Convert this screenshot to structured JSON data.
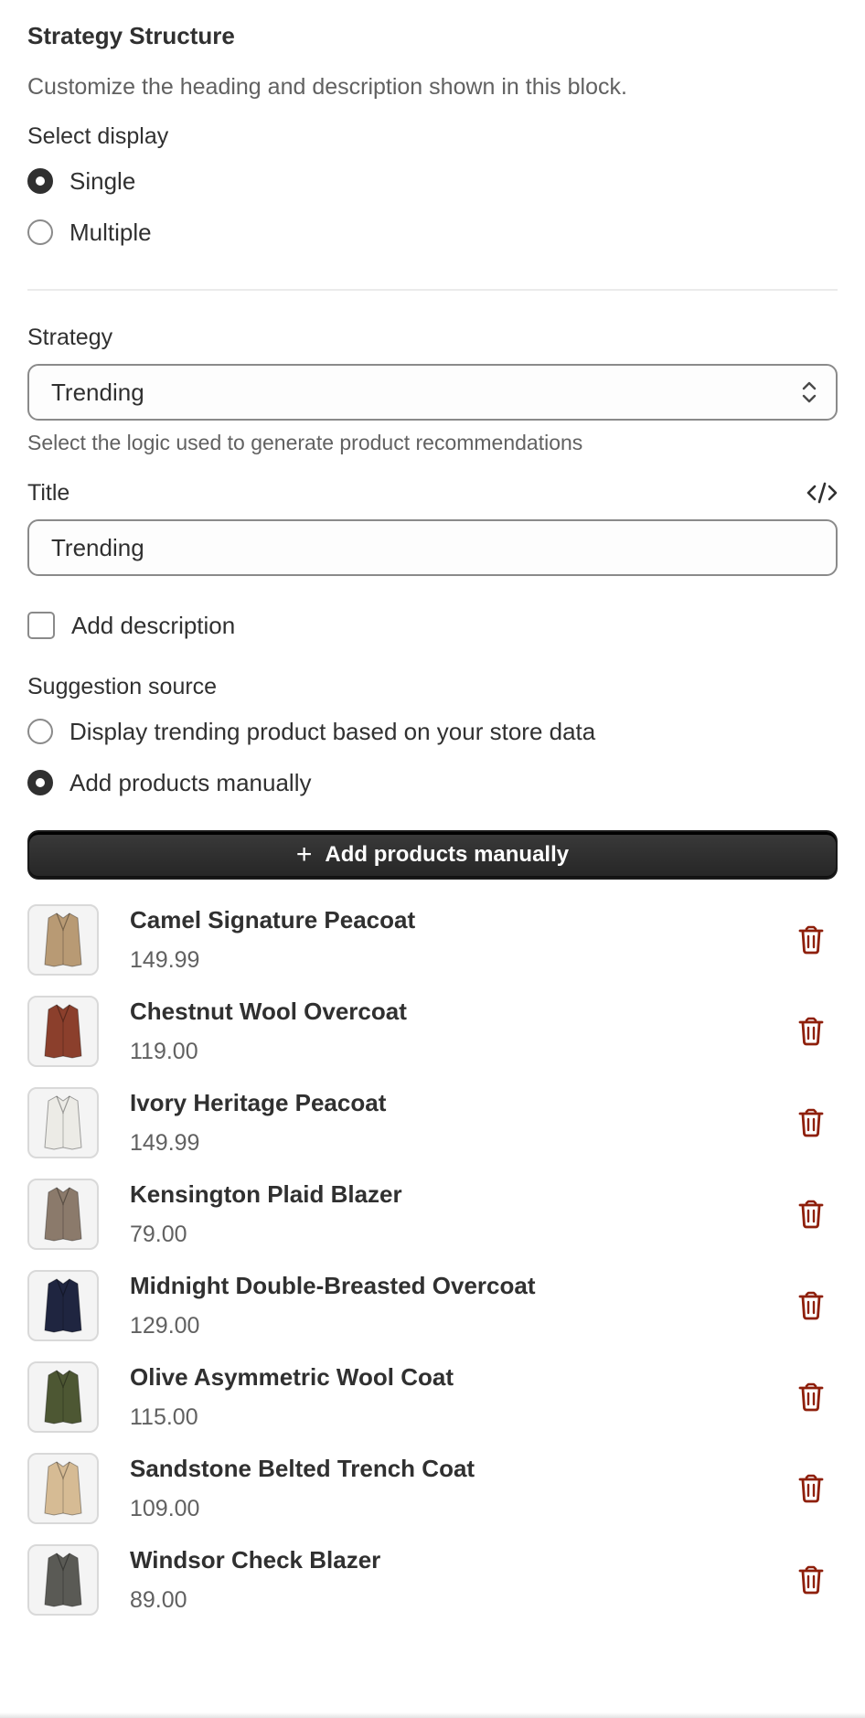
{
  "header": {
    "title": "Strategy Structure",
    "subtitle": "Customize the heading and description shown in this block."
  },
  "display": {
    "label": "Select display",
    "options": [
      {
        "label": "Single",
        "selected": true
      },
      {
        "label": "Multiple",
        "selected": false
      }
    ]
  },
  "strategy": {
    "label": "Strategy",
    "value": "Trending",
    "help": "Select the logic used to generate product recommendations"
  },
  "title_field": {
    "label": "Title",
    "value": "Trending"
  },
  "description": {
    "label": "Add description",
    "checked": false
  },
  "source": {
    "label": "Suggestion source",
    "options": [
      {
        "label": "Display trending product based on your store data",
        "selected": false
      },
      {
        "label": "Add products manually",
        "selected": true
      }
    ]
  },
  "add_button": {
    "label": "Add products manually"
  },
  "products": [
    {
      "name": "Camel Signature Peacoat",
      "price": "149.99",
      "color": "#b89a74"
    },
    {
      "name": "Chestnut Wool Overcoat",
      "price": "119.00",
      "color": "#8b3f2c"
    },
    {
      "name": "Ivory Heritage Peacoat",
      "price": "149.99",
      "color": "#ecebe6"
    },
    {
      "name": "Kensington Plaid Blazer",
      "price": "79.00",
      "color": "#8b7a6b"
    },
    {
      "name": "Midnight Double-Breasted Overcoat",
      "price": "129.00",
      "color": "#1f2540"
    },
    {
      "name": "Olive Asymmetric Wool Coat",
      "price": "115.00",
      "color": "#4d5733"
    },
    {
      "name": "Sandstone Belted Trench Coat",
      "price": "109.00",
      "color": "#d6bb94"
    },
    {
      "name": "Windsor Check Blazer",
      "price": "89.00",
      "color": "#5a5a55"
    }
  ],
  "colors": {
    "text": "#303030",
    "subdued": "#616161",
    "danger": "#8e1f0b",
    "button": "#303030"
  }
}
